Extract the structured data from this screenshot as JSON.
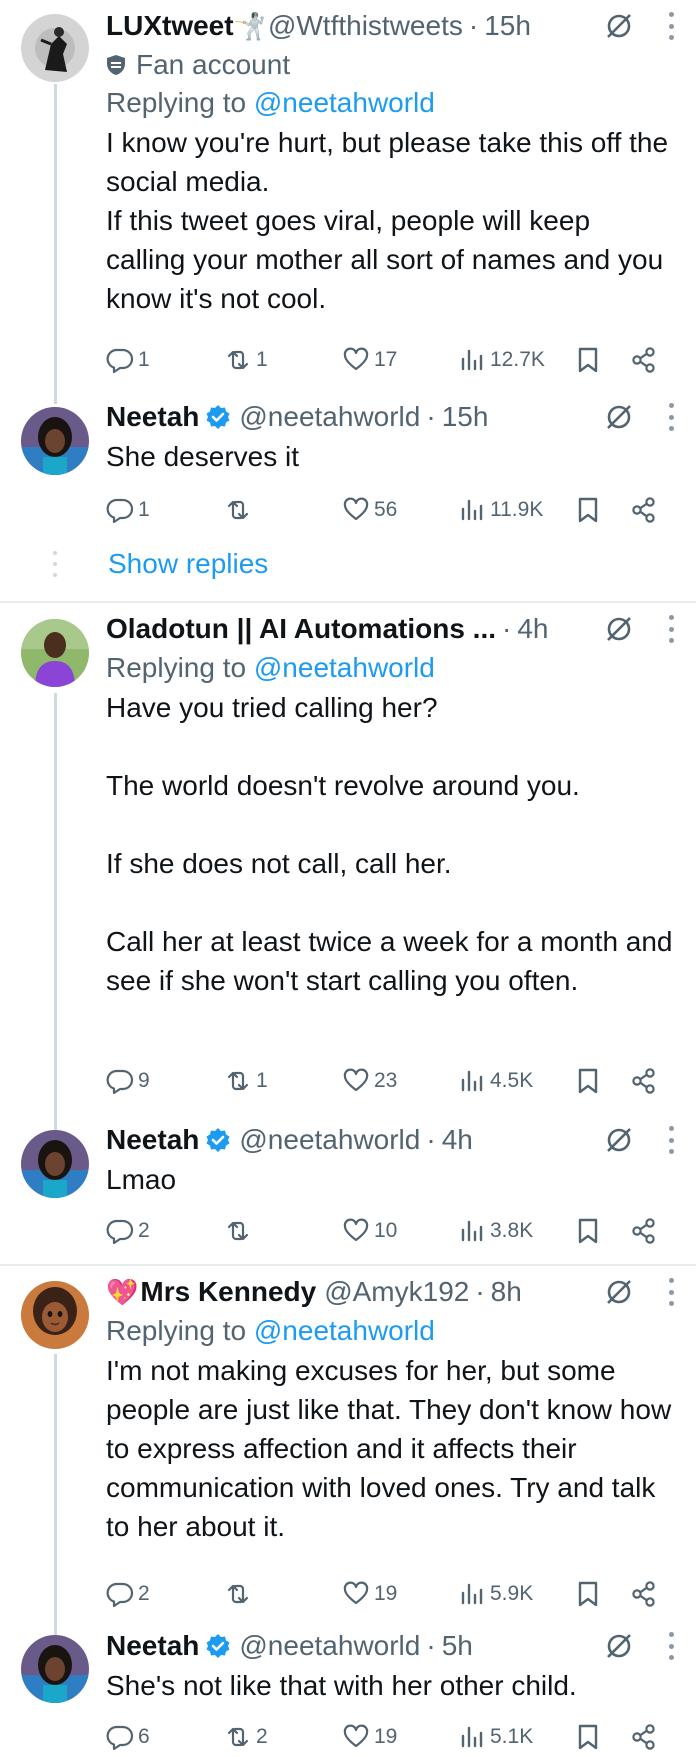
{
  "tweets": [
    {
      "name": "LUXtweet",
      "name_emoji": "🤺",
      "handle": "@Wtfthistweets",
      "time": "15h",
      "label": "Fan account",
      "replying_prefix": "Replying to",
      "replying_to": "@neetahworld",
      "text": [
        "I know you're hurt, but please take this off the social media.",
        "If this tweet goes viral, people will keep calling your mother all sort of names and you know it's not cool."
      ],
      "replies": "1",
      "retweets": "1",
      "likes": "17",
      "views": "12.7K"
    },
    {
      "name": "Neetah",
      "handle": "@neetahworld",
      "time": "15h",
      "verified": true,
      "text": [
        "She deserves it"
      ],
      "replies": "1",
      "retweets": "",
      "likes": "56",
      "views": "11.9K"
    },
    {
      "name": "Oladotun || AI Automations ...",
      "time": "4h",
      "replying_prefix": "Replying to",
      "replying_to": "@neetahworld",
      "text": [
        "Have you tried calling her?",
        "",
        "The world doesn't revolve around you.",
        "",
        "If she does not call, call her.",
        "",
        "Call her at least twice a week for a month and see if she won't start calling you often."
      ],
      "replies": "9",
      "retweets": "1",
      "likes": "23",
      "views": "4.5K"
    },
    {
      "name": "Neetah",
      "handle": "@neetahworld",
      "time": "4h",
      "verified": true,
      "text": [
        "Lmao"
      ],
      "replies": "2",
      "retweets": "",
      "likes": "10",
      "views": "3.8K"
    },
    {
      "name_emoji": "💖",
      "name": "Mrs Kennedy",
      "handle": "@Amyk192",
      "time": "8h",
      "replying_prefix": "Replying to",
      "replying_to": "@neetahworld",
      "text": [
        "I'm not making excuses for her, but some people are just like that. They don't know how to express affection and it affects their communication with loved ones. Try and talk to her about it."
      ],
      "replies": "2",
      "retweets": "",
      "likes": "19",
      "views": "5.9K"
    },
    {
      "name": "Neetah",
      "handle": "@neetahworld",
      "time": "5h",
      "verified": true,
      "text": [
        "She's not like that with her other child."
      ],
      "replies": "6",
      "retweets": "2",
      "likes": "19",
      "views": "5.1K"
    }
  ],
  "show_replies": "Show replies",
  "colors": {
    "link": "#1d9bf0",
    "muted": "#536471",
    "verified": "#1d9bf0",
    "divider": "#e6ecf0"
  },
  "icons": [
    "reply-icon",
    "retweet-icon",
    "like-icon",
    "views-icon",
    "bookmark-icon",
    "share-icon",
    "mute-icon",
    "more-icon",
    "verified-icon"
  ]
}
